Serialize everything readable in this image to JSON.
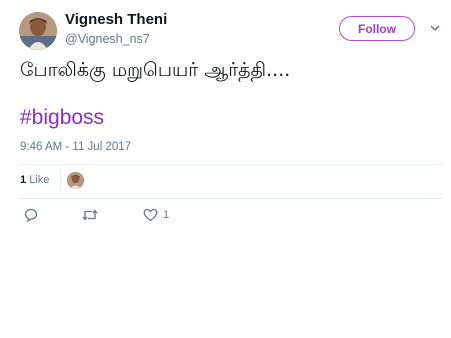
{
  "user": {
    "display_name": "Vignesh Theni",
    "handle": "@Vignesh_ns7"
  },
  "follow_button": {
    "label": "Follow"
  },
  "tweet": {
    "text": "போலிக்கு மறுபெயர் ஆர்த்தி....",
    "hashtag": "#bigboss",
    "timestamp": "9:46 AM - 11 Jul 2017"
  },
  "stats": {
    "like_count": "1",
    "like_label": "Like"
  },
  "actions": {
    "reply_icon": "reply-icon",
    "retweet_icon": "retweet-icon",
    "like_icon": "heart-icon",
    "like_count": "1"
  },
  "colors": {
    "accent": "#9b3fc6",
    "hashtag": "#8f2ad1",
    "muted": "#657786",
    "divider": "#e6ecf0"
  }
}
